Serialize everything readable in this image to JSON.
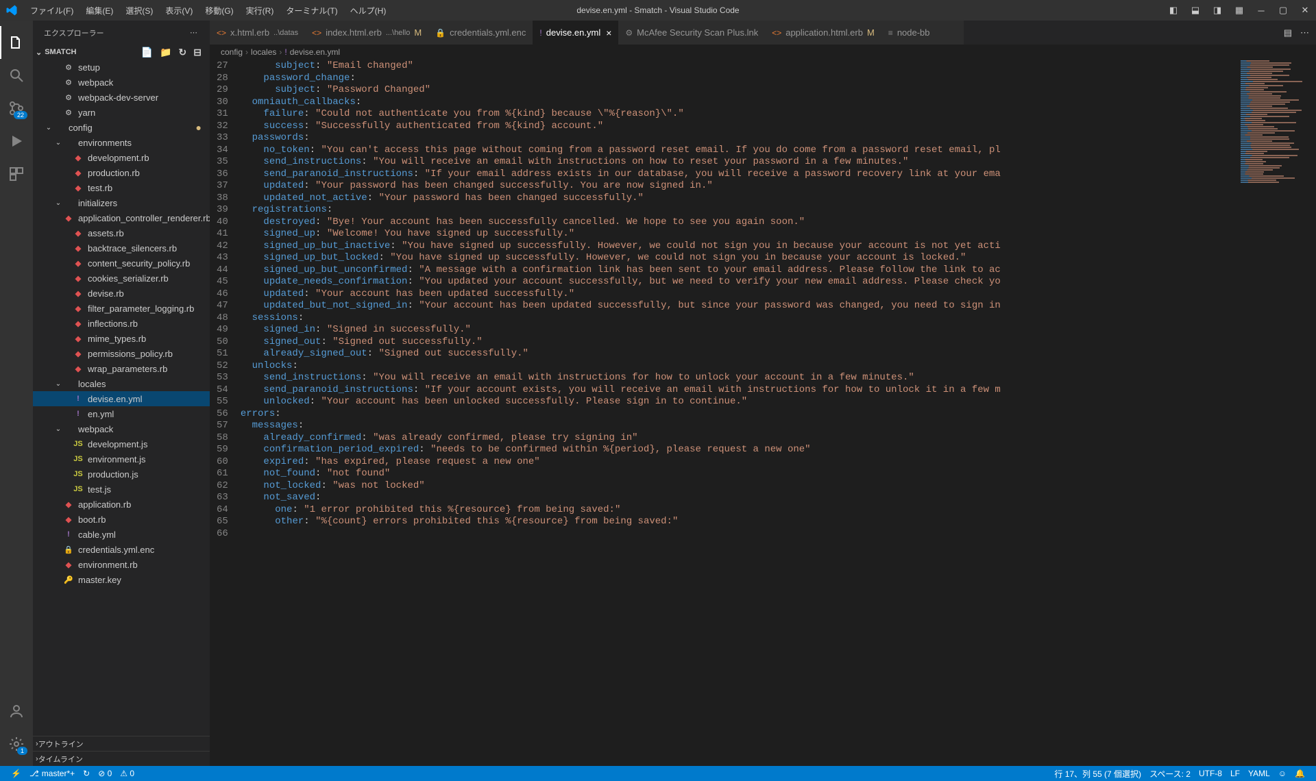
{
  "window": {
    "title": "devise.en.yml - Smatch - Visual Studio Code"
  },
  "menu": [
    "ファイル(F)",
    "編集(E)",
    "選択(S)",
    "表示(V)",
    "移動(G)",
    "実行(R)",
    "ターミナル(T)",
    "ヘルプ(H)"
  ],
  "sidebar": {
    "title": "エクスプローラー",
    "root": "SMATCH",
    "outline": "アウトライン",
    "timeline": "タイムライン"
  },
  "tree": [
    {
      "pad": 30,
      "type": "file",
      "icon": "⚙",
      "label": "setup"
    },
    {
      "pad": 30,
      "type": "file",
      "icon": "⚙",
      "label": "webpack"
    },
    {
      "pad": 30,
      "type": "file",
      "icon": "⚙",
      "label": "webpack-dev-server"
    },
    {
      "pad": 30,
      "type": "file",
      "icon": "⚙",
      "label": "yarn"
    },
    {
      "pad": 16,
      "type": "folder",
      "open": true,
      "label": "config",
      "mod": true
    },
    {
      "pad": 30,
      "type": "folder",
      "open": true,
      "label": "environments"
    },
    {
      "pad": 44,
      "type": "file",
      "iconClass": "icon-rb",
      "label": "development.rb"
    },
    {
      "pad": 44,
      "type": "file",
      "iconClass": "icon-rb",
      "label": "production.rb"
    },
    {
      "pad": 44,
      "type": "file",
      "iconClass": "icon-rb",
      "label": "test.rb"
    },
    {
      "pad": 30,
      "type": "folder",
      "open": true,
      "label": "initializers"
    },
    {
      "pad": 44,
      "type": "file",
      "iconClass": "icon-rb",
      "label": "application_controller_renderer.rb"
    },
    {
      "pad": 44,
      "type": "file",
      "iconClass": "icon-rb",
      "label": "assets.rb"
    },
    {
      "pad": 44,
      "type": "file",
      "iconClass": "icon-rb",
      "label": "backtrace_silencers.rb"
    },
    {
      "pad": 44,
      "type": "file",
      "iconClass": "icon-rb",
      "label": "content_security_policy.rb"
    },
    {
      "pad": 44,
      "type": "file",
      "iconClass": "icon-rb",
      "label": "cookies_serializer.rb"
    },
    {
      "pad": 44,
      "type": "file",
      "iconClass": "icon-rb",
      "label": "devise.rb"
    },
    {
      "pad": 44,
      "type": "file",
      "iconClass": "icon-rb",
      "label": "filter_parameter_logging.rb"
    },
    {
      "pad": 44,
      "type": "file",
      "iconClass": "icon-rb",
      "label": "inflections.rb"
    },
    {
      "pad": 44,
      "type": "file",
      "iconClass": "icon-rb",
      "label": "mime_types.rb"
    },
    {
      "pad": 44,
      "type": "file",
      "iconClass": "icon-rb",
      "label": "permissions_policy.rb"
    },
    {
      "pad": 44,
      "type": "file",
      "iconClass": "icon-rb",
      "label": "wrap_parameters.rb"
    },
    {
      "pad": 30,
      "type": "folder",
      "open": true,
      "label": "locales"
    },
    {
      "pad": 44,
      "type": "file",
      "iconClass": "icon-yml",
      "icon": "!",
      "label": "devise.en.yml",
      "selected": true
    },
    {
      "pad": 44,
      "type": "file",
      "iconClass": "icon-yml",
      "icon": "!",
      "label": "en.yml"
    },
    {
      "pad": 30,
      "type": "folder",
      "open": true,
      "label": "webpack"
    },
    {
      "pad": 44,
      "type": "file",
      "iconClass": "icon-js",
      "icon": "JS",
      "label": "development.js"
    },
    {
      "pad": 44,
      "type": "file",
      "iconClass": "icon-js",
      "icon": "JS",
      "label": "environment.js"
    },
    {
      "pad": 44,
      "type": "file",
      "iconClass": "icon-js",
      "icon": "JS",
      "label": "production.js"
    },
    {
      "pad": 44,
      "type": "file",
      "iconClass": "icon-js",
      "icon": "JS",
      "label": "test.js"
    },
    {
      "pad": 30,
      "type": "file",
      "iconClass": "icon-rb",
      "label": "application.rb"
    },
    {
      "pad": 30,
      "type": "file",
      "iconClass": "icon-rb",
      "label": "boot.rb"
    },
    {
      "pad": 30,
      "type": "file",
      "iconClass": "icon-yml",
      "icon": "!",
      "label": "cable.yml"
    },
    {
      "pad": 30,
      "type": "file",
      "icon": "🔒",
      "label": "credentials.yml.enc"
    },
    {
      "pad": 30,
      "type": "file",
      "iconClass": "icon-rb",
      "label": "environment.rb"
    },
    {
      "pad": 30,
      "type": "file",
      "icon": "🔑",
      "label": "master.key"
    }
  ],
  "tabs": [
    {
      "label": "x.html.erb",
      "desc": "..\\datas",
      "icon": "<>",
      "iconColor": "#e37933"
    },
    {
      "label": "index.html.erb",
      "desc": "...\\hello",
      "mod": "M",
      "icon": "<>",
      "iconColor": "#e37933"
    },
    {
      "label": "credentials.yml.enc",
      "icon": "🔒",
      "iconColor": "#888"
    },
    {
      "label": "devise.en.yml",
      "active": true,
      "icon": "!",
      "iconColor": "#a074c4",
      "close": true
    },
    {
      "label": "McAfee Security Scan Plus.lnk",
      "icon": "⚙",
      "iconColor": "#888"
    },
    {
      "label": "application.html.erb",
      "mod": "M",
      "icon": "<>",
      "iconColor": "#e37933"
    },
    {
      "label": "node-bb",
      "icon": "≡",
      "iconColor": "#888"
    }
  ],
  "breadcrumbs": [
    "config",
    "locales",
    "devise.en.yml"
  ],
  "code_start": 27,
  "code": [
    [
      [
        "      ",
        "p"
      ],
      [
        "subject",
        "k"
      ],
      [
        ": ",
        "p"
      ],
      [
        "\"Email changed\"",
        "s"
      ]
    ],
    [
      [
        "    ",
        "p"
      ],
      [
        "password_change",
        "k"
      ],
      [
        ":",
        "p"
      ]
    ],
    [
      [
        "      ",
        "p"
      ],
      [
        "subject",
        "k"
      ],
      [
        ": ",
        "p"
      ],
      [
        "\"Password Changed\"",
        "s"
      ]
    ],
    [
      [
        "  ",
        "p"
      ],
      [
        "omniauth_callbacks",
        "k"
      ],
      [
        ":",
        "p"
      ]
    ],
    [
      [
        "    ",
        "p"
      ],
      [
        "failure",
        "k"
      ],
      [
        ": ",
        "p"
      ],
      [
        "\"Could not authenticate you from %{kind} because \\\"%{reason}\\\".\"",
        "s"
      ]
    ],
    [
      [
        "    ",
        "p"
      ],
      [
        "success",
        "k"
      ],
      [
        ": ",
        "p"
      ],
      [
        "\"Successfully authenticated from %{kind} account.\"",
        "s"
      ]
    ],
    [
      [
        "  ",
        "p"
      ],
      [
        "passwords",
        "k"
      ],
      [
        ":",
        "p"
      ]
    ],
    [
      [
        "    ",
        "p"
      ],
      [
        "no_token",
        "k"
      ],
      [
        ": ",
        "p"
      ],
      [
        "\"You can't access this page without coming from a password reset email. If you do come from a password reset email, pl",
        "s"
      ]
    ],
    [
      [
        "    ",
        "p"
      ],
      [
        "send_instructions",
        "k"
      ],
      [
        ": ",
        "p"
      ],
      [
        "\"You will receive an email with instructions on how to reset your password in a few minutes.\"",
        "s"
      ]
    ],
    [
      [
        "    ",
        "p"
      ],
      [
        "send_paranoid_instructions",
        "k"
      ],
      [
        ": ",
        "p"
      ],
      [
        "\"If your email address exists in our database, you will receive a password recovery link at your ema",
        "s"
      ]
    ],
    [
      [
        "    ",
        "p"
      ],
      [
        "updated",
        "k"
      ],
      [
        ": ",
        "p"
      ],
      [
        "\"Your password has been changed successfully. You are now signed in.\"",
        "s"
      ]
    ],
    [
      [
        "    ",
        "p"
      ],
      [
        "updated_not_active",
        "k"
      ],
      [
        ": ",
        "p"
      ],
      [
        "\"Your password has been changed successfully.\"",
        "s"
      ]
    ],
    [
      [
        "  ",
        "p"
      ],
      [
        "registrations",
        "k"
      ],
      [
        ":",
        "p"
      ]
    ],
    [
      [
        "    ",
        "p"
      ],
      [
        "destroyed",
        "k"
      ],
      [
        ": ",
        "p"
      ],
      [
        "\"Bye! Your account has been successfully cancelled. We hope to see you again soon.\"",
        "s"
      ]
    ],
    [
      [
        "    ",
        "p"
      ],
      [
        "signed_up",
        "k"
      ],
      [
        ": ",
        "p"
      ],
      [
        "\"Welcome! You have signed up successfully.\"",
        "s"
      ]
    ],
    [
      [
        "    ",
        "p"
      ],
      [
        "signed_up_but_inactive",
        "k"
      ],
      [
        ": ",
        "p"
      ],
      [
        "\"You have signed up successfully. However, we could not sign you in because your account is not yet acti",
        "s"
      ]
    ],
    [
      [
        "    ",
        "p"
      ],
      [
        "signed_up_but_locked",
        "k"
      ],
      [
        ": ",
        "p"
      ],
      [
        "\"You have signed up successfully. However, we could not sign you in because your account is locked.\"",
        "s"
      ]
    ],
    [
      [
        "    ",
        "p"
      ],
      [
        "signed_up_but_unconfirmed",
        "k"
      ],
      [
        ": ",
        "p"
      ],
      [
        "\"A message with a confirmation link has been sent to your email address. Please follow the link to ac",
        "s"
      ]
    ],
    [
      [
        "    ",
        "p"
      ],
      [
        "update_needs_confirmation",
        "k"
      ],
      [
        ": ",
        "p"
      ],
      [
        "\"You updated your account successfully, but we need to verify your new email address. Please check yo",
        "s"
      ]
    ],
    [
      [
        "    ",
        "p"
      ],
      [
        "updated",
        "k"
      ],
      [
        ": ",
        "p"
      ],
      [
        "\"Your account has been updated successfully.\"",
        "s"
      ]
    ],
    [
      [
        "    ",
        "p"
      ],
      [
        "updated_but_not_signed_in",
        "k"
      ],
      [
        ": ",
        "p"
      ],
      [
        "\"Your account has been updated successfully, but since your password was changed, you need to sign in",
        "s"
      ]
    ],
    [
      [
        "  ",
        "p"
      ],
      [
        "sessions",
        "k"
      ],
      [
        ":",
        "p"
      ]
    ],
    [
      [
        "    ",
        "p"
      ],
      [
        "signed_in",
        "k"
      ],
      [
        ": ",
        "p"
      ],
      [
        "\"Signed in successfully.\"",
        "s"
      ]
    ],
    [
      [
        "    ",
        "p"
      ],
      [
        "signed_out",
        "k"
      ],
      [
        ": ",
        "p"
      ],
      [
        "\"Signed out successfully.\"",
        "s"
      ]
    ],
    [
      [
        "    ",
        "p"
      ],
      [
        "already_signed_out",
        "k"
      ],
      [
        ": ",
        "p"
      ],
      [
        "\"Signed out successfully.\"",
        "s"
      ]
    ],
    [
      [
        "  ",
        "p"
      ],
      [
        "unlocks",
        "k"
      ],
      [
        ":",
        "p"
      ]
    ],
    [
      [
        "    ",
        "p"
      ],
      [
        "send_instructions",
        "k"
      ],
      [
        ": ",
        "p"
      ],
      [
        "\"You will receive an email with instructions for how to unlock your account in a few minutes.\"",
        "s"
      ]
    ],
    [
      [
        "    ",
        "p"
      ],
      [
        "send_paranoid_instructions",
        "k"
      ],
      [
        ": ",
        "p"
      ],
      [
        "\"If your account exists, you will receive an email with instructions for how to unlock it in a few m",
        "s"
      ]
    ],
    [
      [
        "    ",
        "p"
      ],
      [
        "unlocked",
        "k"
      ],
      [
        ": ",
        "p"
      ],
      [
        "\"Your account has been unlocked successfully. Please sign in to continue.\"",
        "s"
      ]
    ],
    [
      [
        "",
        "p"
      ],
      [
        "errors",
        "k"
      ],
      [
        ":",
        "p"
      ]
    ],
    [
      [
        "  ",
        "p"
      ],
      [
        "messages",
        "k"
      ],
      [
        ":",
        "p"
      ]
    ],
    [
      [
        "    ",
        "p"
      ],
      [
        "already_confirmed",
        "k"
      ],
      [
        ": ",
        "p"
      ],
      [
        "\"was already confirmed, please try signing in\"",
        "s"
      ]
    ],
    [
      [
        "    ",
        "p"
      ],
      [
        "confirmation_period_expired",
        "k"
      ],
      [
        ": ",
        "p"
      ],
      [
        "\"needs to be confirmed within %{period}, please request a new one\"",
        "s"
      ]
    ],
    [
      [
        "    ",
        "p"
      ],
      [
        "expired",
        "k"
      ],
      [
        ": ",
        "p"
      ],
      [
        "\"has expired, please request a new one\"",
        "s"
      ]
    ],
    [
      [
        "    ",
        "p"
      ],
      [
        "not_found",
        "k"
      ],
      [
        ": ",
        "p"
      ],
      [
        "\"not found\"",
        "s"
      ]
    ],
    [
      [
        "    ",
        "p"
      ],
      [
        "not_locked",
        "k"
      ],
      [
        ": ",
        "p"
      ],
      [
        "\"was not locked\"",
        "s"
      ]
    ],
    [
      [
        "    ",
        "p"
      ],
      [
        "not_saved",
        "k"
      ],
      [
        ":",
        "p"
      ]
    ],
    [
      [
        "      ",
        "p"
      ],
      [
        "one",
        "k"
      ],
      [
        ": ",
        "p"
      ],
      [
        "\"1 error prohibited this %{resource} from being saved:\"",
        "s"
      ]
    ],
    [
      [
        "      ",
        "p"
      ],
      [
        "other",
        "k"
      ],
      [
        ": ",
        "p"
      ],
      [
        "\"%{count} errors prohibited this %{resource} from being saved:\"",
        "s"
      ]
    ],
    [
      [
        "",
        "p"
      ]
    ]
  ],
  "statusbar": {
    "branch": "master*+",
    "sync": "↻",
    "errors": "⊘ 0",
    "warnings": "⚠ 0",
    "position": "行 17、列 55 (7 個選択)",
    "spaces": "スペース: 2",
    "encoding": "UTF-8",
    "eol": "LF",
    "lang": "YAML",
    "feedback": "☺",
    "bell": "🔔"
  },
  "badges": {
    "scm": "22",
    "gear": "1"
  }
}
